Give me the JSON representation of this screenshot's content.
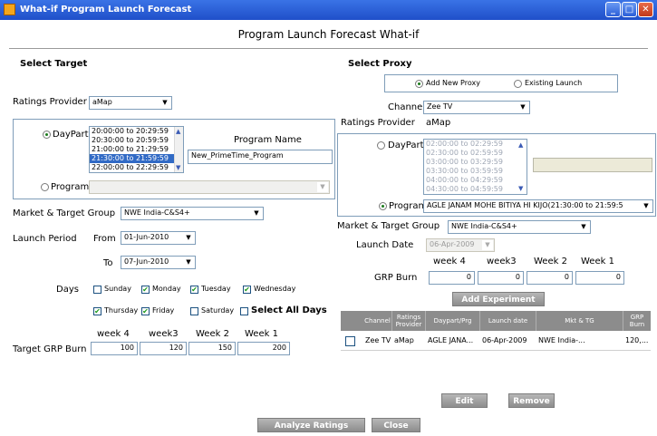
{
  "window": {
    "title": "What-if Program Launch Forecast",
    "min": "_",
    "max": "□",
    "close": "✕"
  },
  "main_title": "Program Launch Forecast What-if",
  "left": {
    "section_title": "Select Target",
    "ratings_provider_label": "Ratings Provider",
    "ratings_provider_value": "aMap",
    "daypart_label": "DayPart",
    "daypart_items": [
      "20:00:00 to 20:29:59",
      "20:30:00 to 20:59:59",
      "21:00:00 to 21:29:59",
      "21:30:00 to 21:59:59",
      "22:00:00 to 22:29:59"
    ],
    "program_name_label": "Program Name",
    "program_name_value": "New_PrimeTime_Program",
    "program_label": "Program",
    "program_value": "",
    "market_label": "Market & Target Group",
    "market_value": "NWE India-C&S4+",
    "launch_period_label": "Launch Period",
    "from_label": "From",
    "from_value": "01-Jun-2010",
    "to_label": "To",
    "to_value": "07-Jun-2010",
    "days_label": "Days",
    "days": [
      {
        "label": "Sunday",
        "checked": false
      },
      {
        "label": "Monday",
        "checked": true
      },
      {
        "label": "Tuesday",
        "checked": true
      },
      {
        "label": "Wednesday",
        "checked": true
      },
      {
        "label": "Thursday",
        "checked": true
      },
      {
        "label": "Friday",
        "checked": true
      },
      {
        "label": "Saturday",
        "checked": false
      }
    ],
    "select_all_label": "Select All Days",
    "week_headers": [
      "week 4",
      "week3",
      "Week 2",
      "Week 1"
    ],
    "grp_label": "Target GRP Burn",
    "grp_values": [
      "100",
      "120",
      "150",
      "200"
    ]
  },
  "right": {
    "section_title": "Select Proxy",
    "add_new_proxy": "Add New Proxy",
    "existing_launch": "Existing Launch",
    "channel_label": "Channel",
    "channel_value": "Zee TV",
    "ratings_provider_label": "Ratings Provider",
    "ratings_provider_value": "aMap",
    "daypart_label": "DayPart",
    "daypart_items": [
      "02:00:00 to 02:29:59",
      "02:30:00 to 02:59:59",
      "03:00:00 to 03:29:59",
      "03:30:00 to 03:59:59",
      "04:00:00 to 04:29:59",
      "04:30:00 to 04:59:59"
    ],
    "program_label": "Program",
    "program_value": "AGLE JANAM MOHE BITIYA HI KIJO(21:30:00 to 21:59:5",
    "market_label": "Market & Target Group",
    "market_value": "NWE India-C&S4+",
    "launch_date_label": "Launch Date",
    "launch_date_value": "06-Apr-2009",
    "week_headers": [
      "week 4",
      "week3",
      "Week 2",
      "Week 1"
    ],
    "grp_label": "GRP Burn",
    "grp_values": [
      "0",
      "0",
      "0",
      "0"
    ],
    "add_experiment": "Add Experiment",
    "grid_headers": [
      "Channel",
      "Ratings Provider",
      "Daypart/Prg",
      "Launch date",
      "Mkt & TG",
      "GRP Burn"
    ],
    "grid_row": [
      "Zee TV",
      "aMap",
      "AGLE JANA...",
      "06-Apr-2009",
      "NWE India-...",
      "120,..."
    ],
    "edit": "Edit",
    "remove": "Remove"
  },
  "footer": {
    "analyze": "Analyze Ratings",
    "close": "Close"
  },
  "icons": {
    "dropdown": "▼",
    "up": "▲",
    "down": "▼"
  }
}
